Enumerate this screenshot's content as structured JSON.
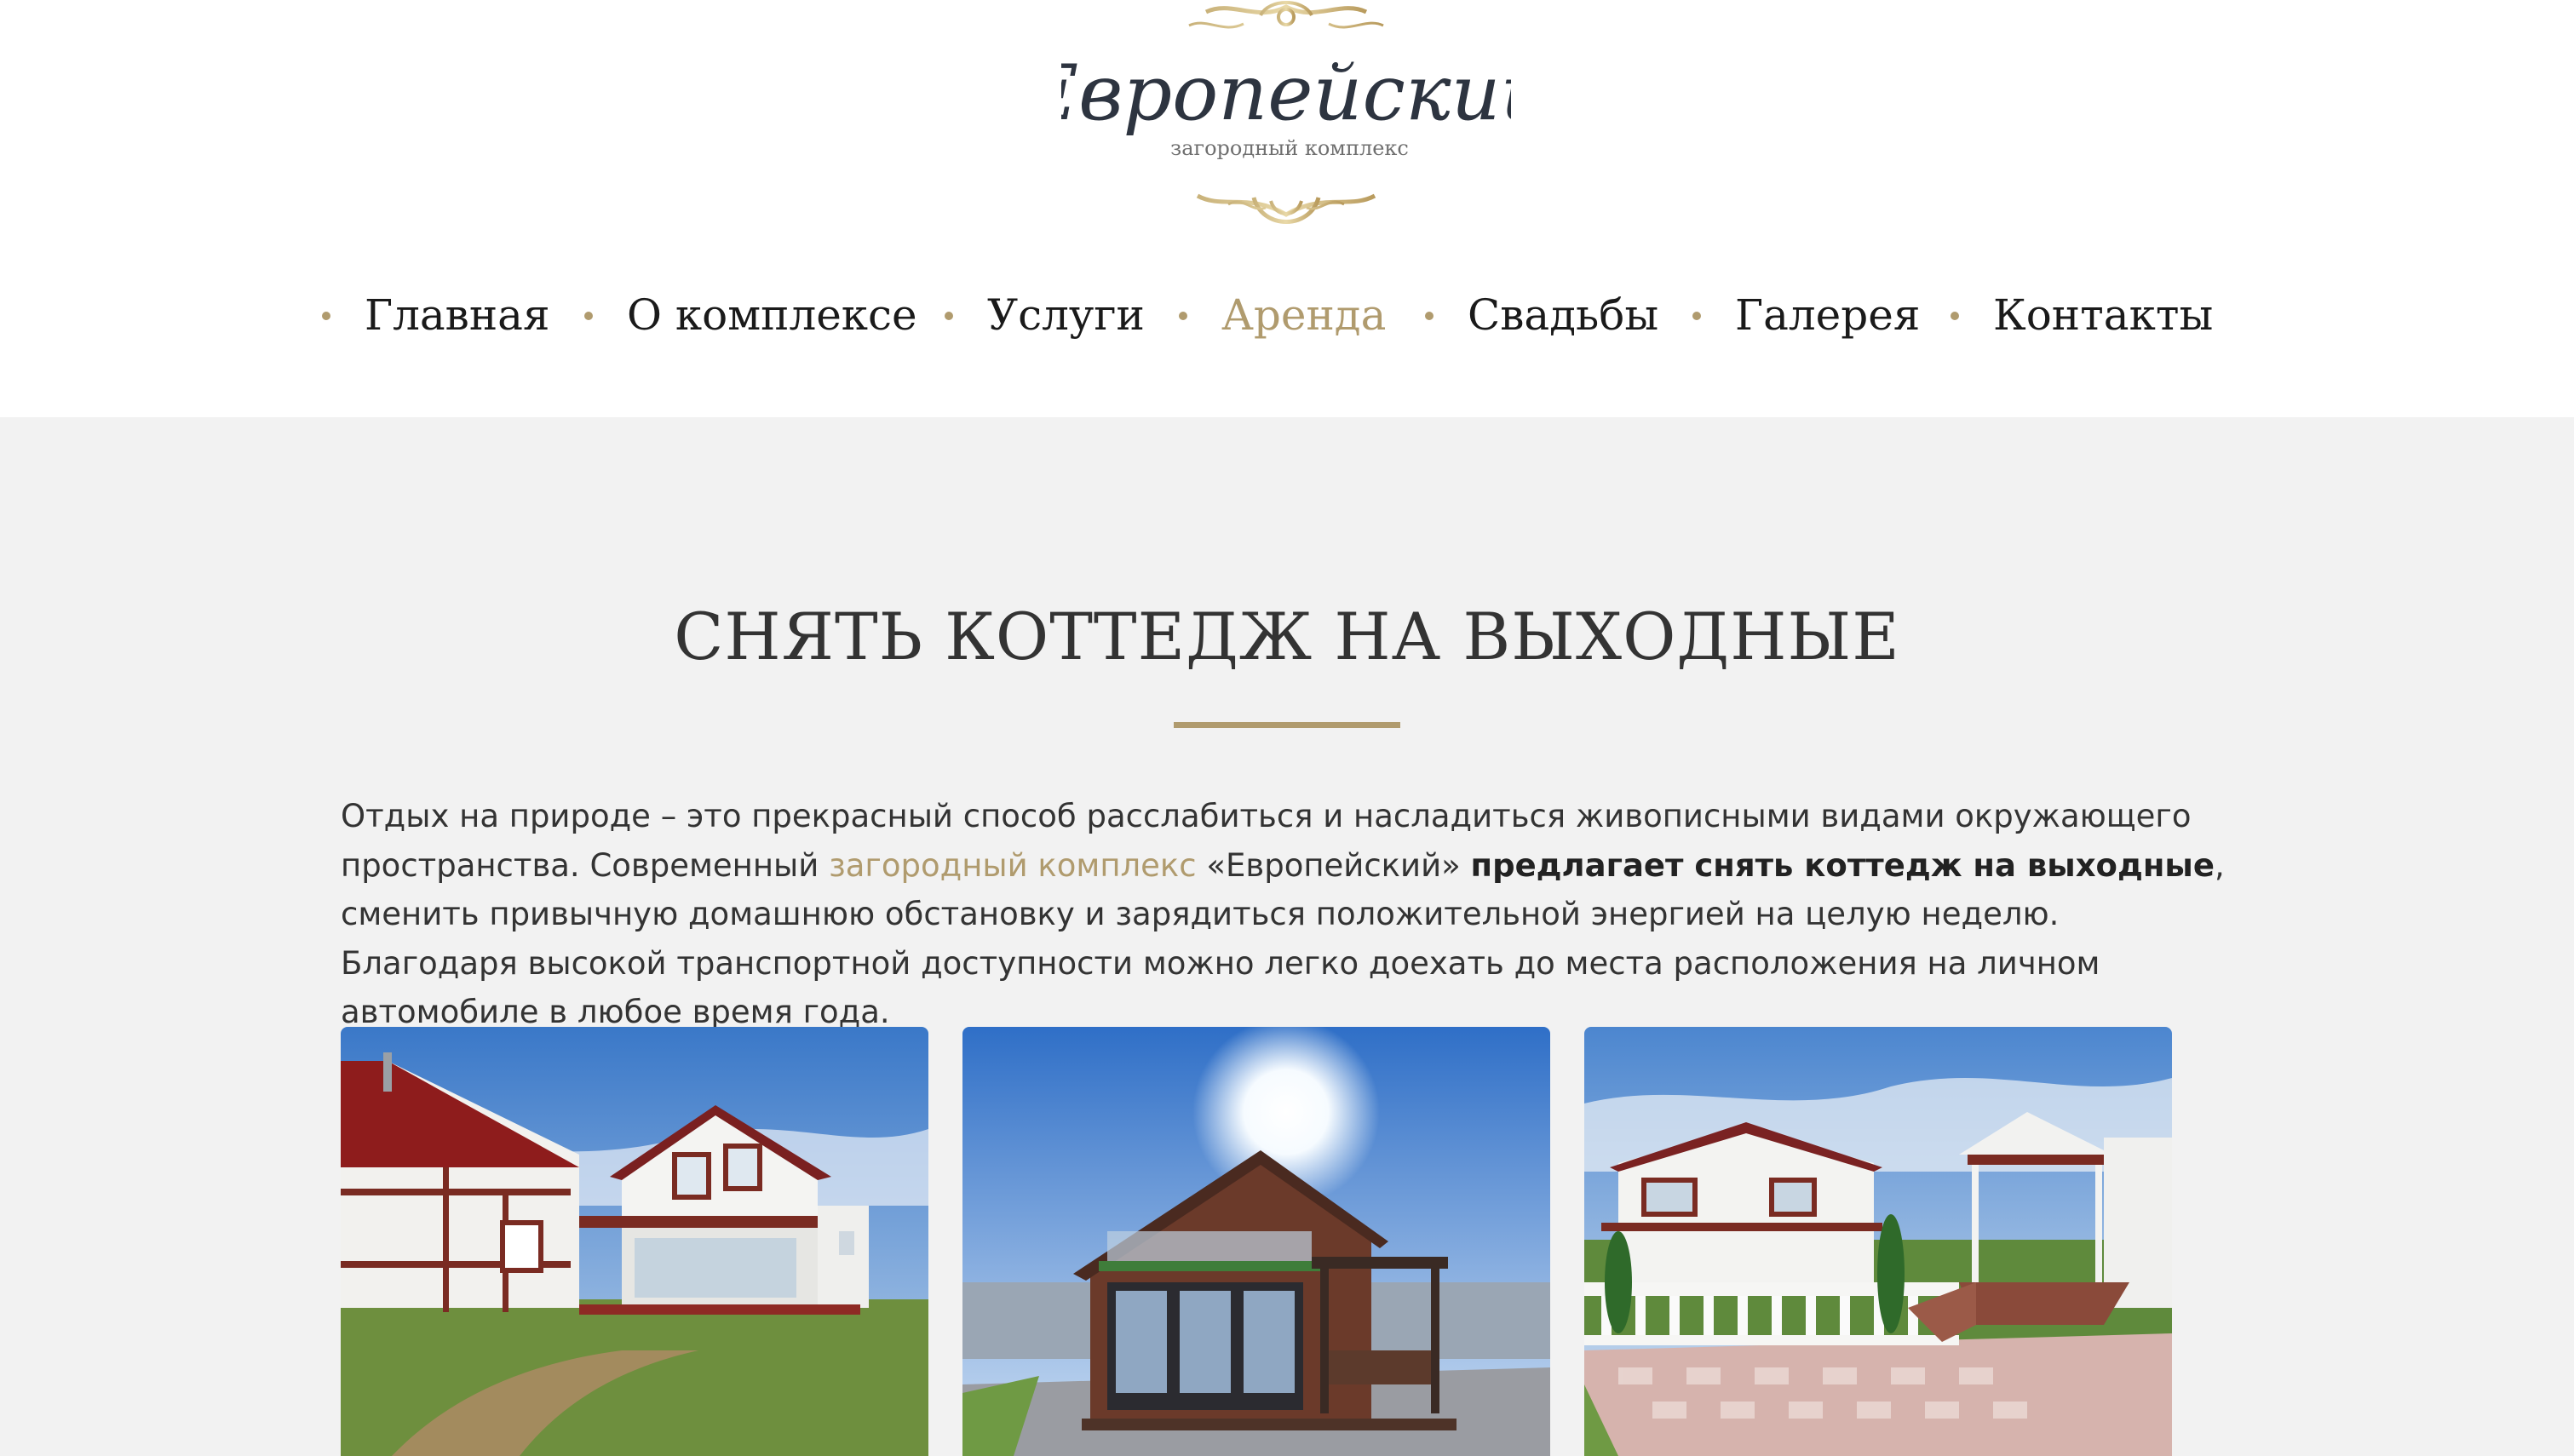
{
  "logo": {
    "name": "Европейский",
    "tagline": "загородный комплекс"
  },
  "nav": {
    "items": [
      {
        "label": "Главная",
        "active": false
      },
      {
        "label": "О комплексе",
        "active": false
      },
      {
        "label": "Услуги",
        "active": false
      },
      {
        "label": "Аренда",
        "active": true
      },
      {
        "label": "Свадьбы",
        "active": false
      },
      {
        "label": "Галерея",
        "active": false
      },
      {
        "label": "Контакты",
        "active": false
      }
    ]
  },
  "content": {
    "title": "СНЯТЬ КОТТЕДЖ НА ВЫХОДНЫЕ",
    "intro": {
      "part1": "Отдых на природе – это прекрасный способ расслабиться и насладиться живописными видами окружающего пространства. Современный ",
      "link": "загородный комплекс",
      "part2": " «Европейский» ",
      "bold": "предлагает снять коттедж на выходные",
      "part3": ", сменить привычную домашнюю обстановку и зарядиться положительной энергией на целую неделю. Благодаря высокой транспортной доступности можно легко доехать до места расположения на личном автомобиле в любое время года."
    },
    "gallery": [
      {
        "name": "cottage-photo-white-red"
      },
      {
        "name": "cottage-photo-brown-sun"
      },
      {
        "name": "cottage-photo-terrace"
      }
    ]
  },
  "colors": {
    "accent": "#b09b6e",
    "text": "#333333",
    "content_bg": "#f2f2f2",
    "header_bg": "#ffffff"
  }
}
